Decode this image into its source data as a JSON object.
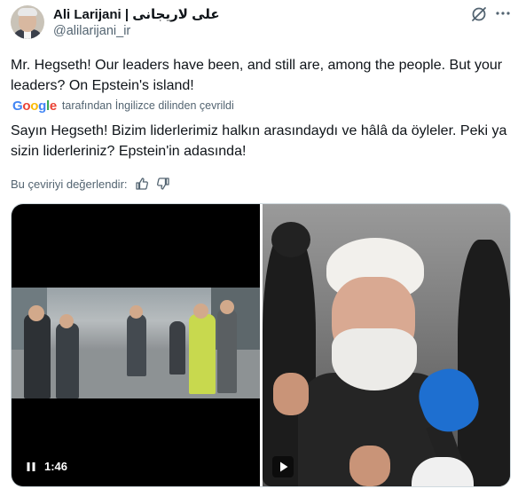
{
  "author": {
    "display_name": "Ali Larijani | علی لاریجانی",
    "handle": "@alilarijani_ir"
  },
  "tweet": {
    "text": "Mr. Hegseth! Our leaders have been, and still are, among the people. But your leaders? On Epstein's island!",
    "translation_source_label": "tarafından İngilizce dilinden çevrildi",
    "translated_text": "Sayın Hegseth! Bizim liderlerimiz halkın arasındaydı ve hâlâ da öyleler. Peki ya sizin liderleriniz? Epstein'in adasında!",
    "rate_translation_label": "Bu çeviriyi değerlendir:"
  },
  "google_logo": "Google",
  "media": {
    "video1": {
      "duration": "1:46",
      "control": "pause-icon"
    },
    "video2": {
      "control": "play-icon"
    }
  },
  "icons": [
    "grok-icon",
    "more-icon",
    "thumbs-up-icon",
    "thumbs-down-icon"
  ]
}
